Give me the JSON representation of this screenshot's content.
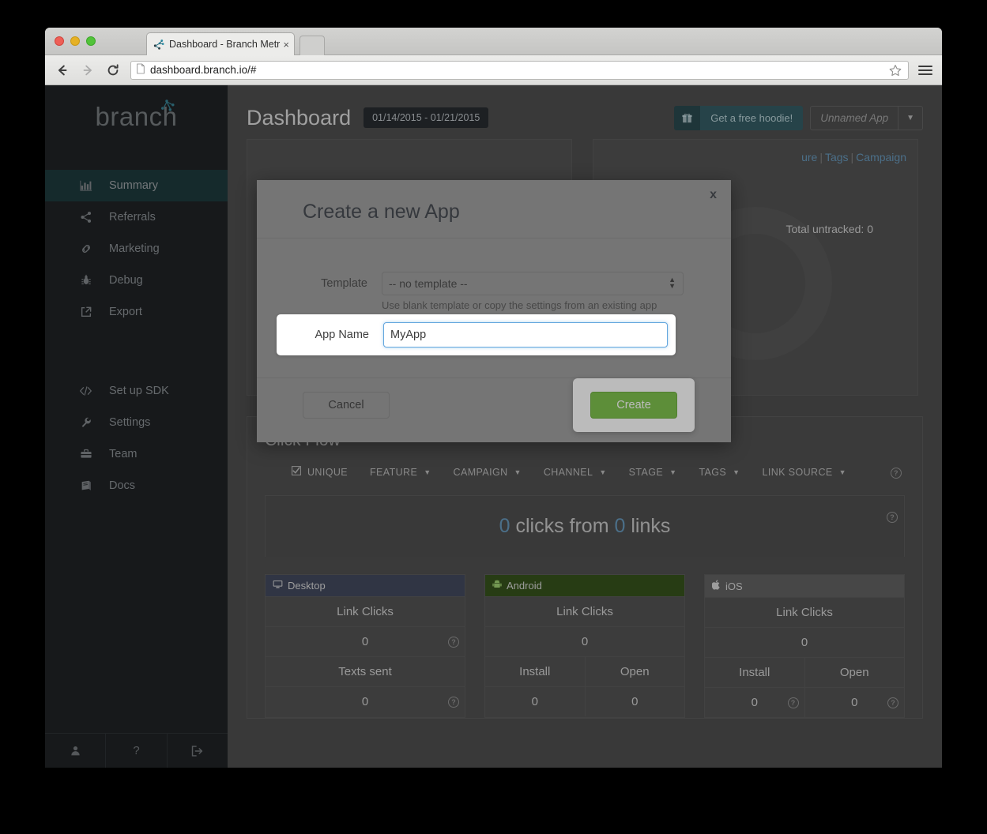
{
  "browser": {
    "tab": {
      "title": "Dashboard - Branch Metric",
      "close_label": "×",
      "favicon": "branch-logo-icon"
    },
    "nav": {
      "back": "←",
      "forward": "→",
      "reload": "⟳"
    },
    "address": "dashboard.branch.io/#",
    "bookmark_icon": "star-icon",
    "menu_icon": "hamburger-menu-icon"
  },
  "sidebar": {
    "brand": "branch",
    "items": [
      {
        "label": "Summary",
        "icon": "bar-chart-icon",
        "active": true
      },
      {
        "label": "Referrals",
        "icon": "share-icon",
        "active": false
      },
      {
        "label": "Marketing",
        "icon": "link-icon",
        "active": false
      },
      {
        "label": "Debug",
        "icon": "bug-icon",
        "active": false
      },
      {
        "label": "Export",
        "icon": "external-link-icon",
        "active": false
      }
    ],
    "items2": [
      {
        "label": "Set up SDK",
        "icon": "code-icon"
      },
      {
        "label": "Settings",
        "icon": "wrench-icon"
      },
      {
        "label": "Team",
        "icon": "briefcase-icon"
      },
      {
        "label": "Docs",
        "icon": "book-icon"
      }
    ],
    "footer": [
      {
        "icon": "user-icon",
        "label": ""
      },
      {
        "icon": "help-icon",
        "label": "?"
      },
      {
        "icon": "logout-icon",
        "label": ""
      }
    ]
  },
  "header": {
    "title": "Dashboard",
    "date_range": "01/14/2015 - 01/21/2015",
    "hoodie_label": "Get a free hoodie!",
    "hoodie_icon": "gift-icon",
    "app_name": "Unnamed App",
    "caret": "▼"
  },
  "background": {
    "card_links": [
      "ure",
      "Tags",
      "Campaign"
    ],
    "link_separator": "|",
    "total_untracked": "Total untracked: 0"
  },
  "clickflow": {
    "title": "Click Flow",
    "unique_label": "UNIQUE",
    "unique_checked": true,
    "filters": [
      "FEATURE",
      "CAMPAIGN",
      "CHANNEL",
      "STAGE",
      "TAGS",
      "LINK SOURCE"
    ],
    "caret": "▼",
    "help_icon": "help-circle-icon",
    "summary": {
      "clicks": "0",
      "mid": "clicks from",
      "links": "0",
      "tail": "links"
    },
    "platforms": [
      {
        "name": "Desktop",
        "icon": "desktop-icon",
        "color": "#383f55",
        "rows": [
          {
            "cells": [
              {
                "label": "Link Clicks"
              }
            ]
          },
          {
            "cells": [
              {
                "value": "0",
                "help": true
              }
            ]
          },
          {
            "cells": [
              {
                "label": "Texts sent"
              }
            ]
          },
          {
            "cells": [
              {
                "value": "0",
                "help": true
              }
            ]
          }
        ]
      },
      {
        "name": "Android",
        "icon": "android-icon",
        "color": "#2c4a10",
        "rows": [
          {
            "cells": [
              {
                "label": "Link Clicks"
              }
            ]
          },
          {
            "cells": [
              {
                "value": "0",
                "help": false
              }
            ]
          },
          {
            "cells": [
              {
                "label": "Install"
              },
              {
                "label": "Open"
              }
            ]
          },
          {
            "cells": [
              {
                "value": "0",
                "help": false
              },
              {
                "value": "0",
                "help": false
              }
            ]
          }
        ]
      },
      {
        "name": "iOS",
        "icon": "apple-icon",
        "color": "#5a5a5a",
        "rows": [
          {
            "cells": [
              {
                "label": "Link Clicks"
              }
            ]
          },
          {
            "cells": [
              {
                "value": "0",
                "help": false
              }
            ]
          },
          {
            "cells": [
              {
                "label": "Install"
              },
              {
                "label": "Open"
              }
            ]
          },
          {
            "cells": [
              {
                "value": "0",
                "help": true
              },
              {
                "value": "0",
                "help": true
              }
            ]
          }
        ]
      }
    ]
  },
  "modal": {
    "title": "Create a new App",
    "close_label": "x",
    "template_label": "Template",
    "template_value": "-- no template --",
    "template_options": [
      "-- no template --"
    ],
    "template_help": "Use blank template or copy the settings from an existing app",
    "appname_label": "App Name",
    "appname_value": "MyApp",
    "appname_placeholder": "",
    "cancel_label": "Cancel",
    "create_label": "Create",
    "create_color": "#79bf45"
  }
}
